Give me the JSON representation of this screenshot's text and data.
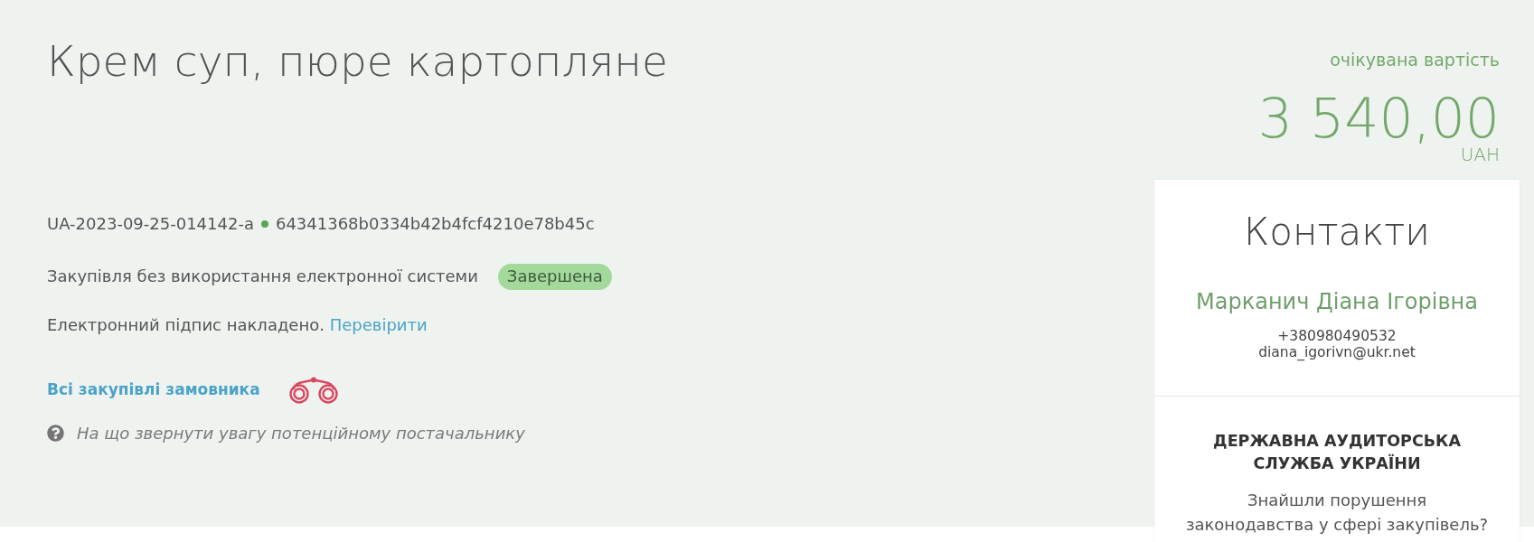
{
  "tender": {
    "title": "Крем суп, пюре картопляне",
    "id": "UA-2023-09-25-014142-a",
    "hash": "64341368b0334b42b4fcf4210e78b45c",
    "procurement_type": "Закупівля без використання електронної системи",
    "status": "Завершена",
    "signature": {
      "text": "Електронний підпис накладено.",
      "link": "Перевірити"
    },
    "buyer_link": "Всі закупівлі замовника",
    "help_link": "На що звернути увагу потенційному постачальнику"
  },
  "price": {
    "label": "очікувана вартість",
    "amount": "3 540,00",
    "currency": "UAH"
  },
  "contacts": {
    "title": "Контакти",
    "name": "Марканич Діана Ігорівна",
    "phone": "+380980490532",
    "email": "diana_igorivn@ukr.net"
  },
  "audit": {
    "title": "ДЕРЖАВНА АУДИТОРСЬКА СЛУЖБА УКРАЇНИ",
    "text": "Знайшли порушення законодавства у сфері закупівель?"
  }
}
